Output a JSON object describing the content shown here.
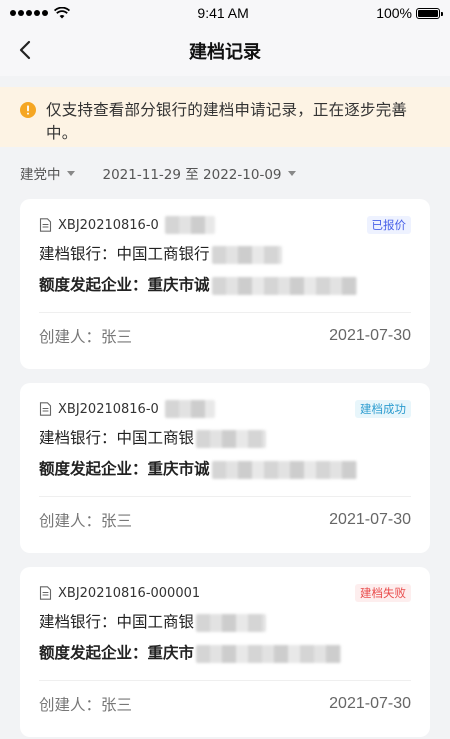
{
  "status_bar": {
    "time": "9:41 AM",
    "battery": "100%"
  },
  "nav": {
    "title": "建档记录"
  },
  "notice": {
    "text": "仅支持查看部分银行的建档申请记录，正在逐步完善中。"
  },
  "filters": {
    "status": "建党中",
    "date_range": "2021-11-29 至 2022-10-09"
  },
  "colors": {
    "notice_bg": "#fdf3e4",
    "notice_icon": "#f5a623",
    "badge_quoted": "#4a62e8",
    "badge_success": "#2d9ccf",
    "badge_failed": "#e94a4a"
  },
  "records": [
    {
      "no": "XBJ20210816-0",
      "status": "已报价",
      "status_type": "quoted",
      "bank_label": "建档银行：",
      "bank": "中国工商银行",
      "company_label": "额度发起企业：",
      "company": "重庆市诚",
      "creator_label": "创建人：",
      "creator": "张三",
      "date": "2021-07-30"
    },
    {
      "no": "XBJ20210816-0",
      "status": "建档成功",
      "status_type": "success",
      "bank_label": "建档银行：",
      "bank": "中国工商银",
      "company_label": "额度发起企业：",
      "company": "重庆市诚",
      "creator_label": "创建人：",
      "creator": "张三",
      "date": "2021-07-30"
    },
    {
      "no": "XBJ20210816-000001",
      "status": "建档失败",
      "status_type": "failed",
      "bank_label": "建档银行：",
      "bank": "中国工商银",
      "company_label": "额度发起企业：",
      "company": "重庆市",
      "creator_label": "创建人：",
      "creator": "张三",
      "date": "2021-07-30"
    }
  ]
}
